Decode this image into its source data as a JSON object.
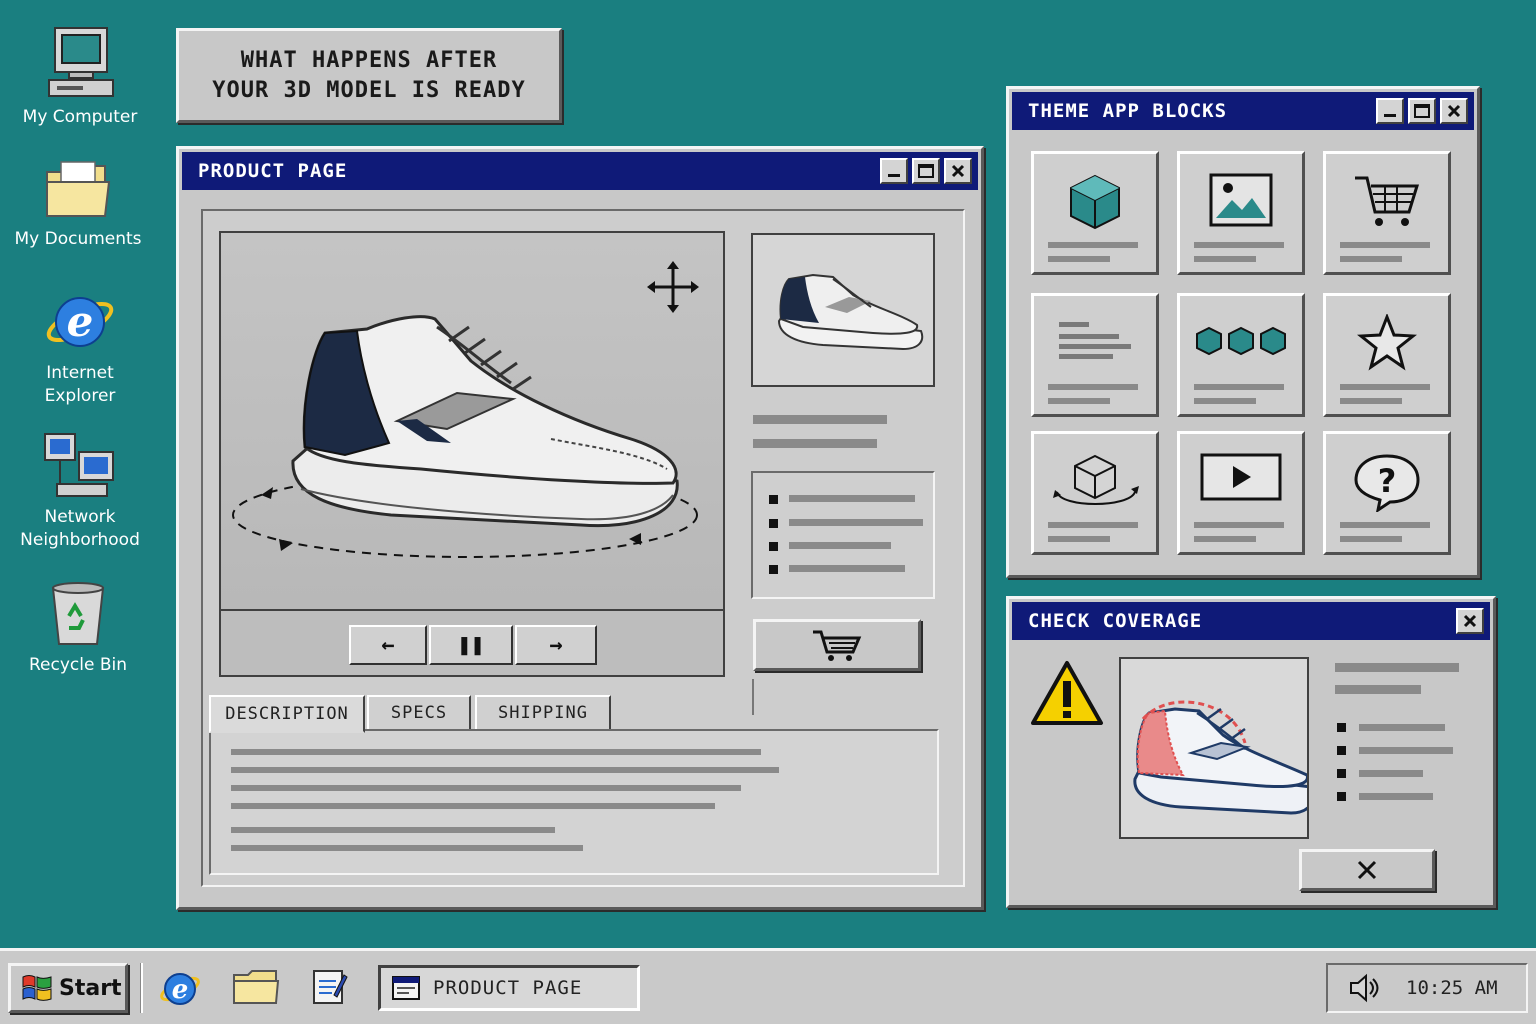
{
  "desktop": {
    "icons": [
      {
        "label": "My Computer"
      },
      {
        "label": "My Documents"
      },
      {
        "label": "Internet\nExplorer"
      },
      {
        "label": "Network\nNeighborhood"
      },
      {
        "label": "Recycle Bin"
      }
    ]
  },
  "headline": "WHAT HAPPENS AFTER\nYOUR 3D MODEL IS READY",
  "product_window": {
    "title": "PRODUCT PAGE",
    "tabs": [
      "DESCRIPTION",
      "SPECS",
      "SHIPPING"
    ]
  },
  "blocks_window": {
    "title": "THEME APP BLOCKS",
    "tiles": [
      "cube-icon",
      "image-icon",
      "cart-icon",
      "text-icon",
      "carousel-icon",
      "star-icon",
      "rotate-3d-icon",
      "video-icon",
      "question-icon"
    ]
  },
  "coverage_window": {
    "title": "CHECK COVERAGE"
  },
  "taskbar": {
    "start_label": "Start",
    "task_label": "PRODUCT PAGE",
    "clock": "10:25 AM"
  },
  "colors": {
    "desktop": "#1a7f80",
    "titlebar": "#0f1a78",
    "window": "#c8c8c8",
    "teal_accent": "#2a8a8a",
    "warning": "#f5d000",
    "coverage_red": "#e05050"
  }
}
